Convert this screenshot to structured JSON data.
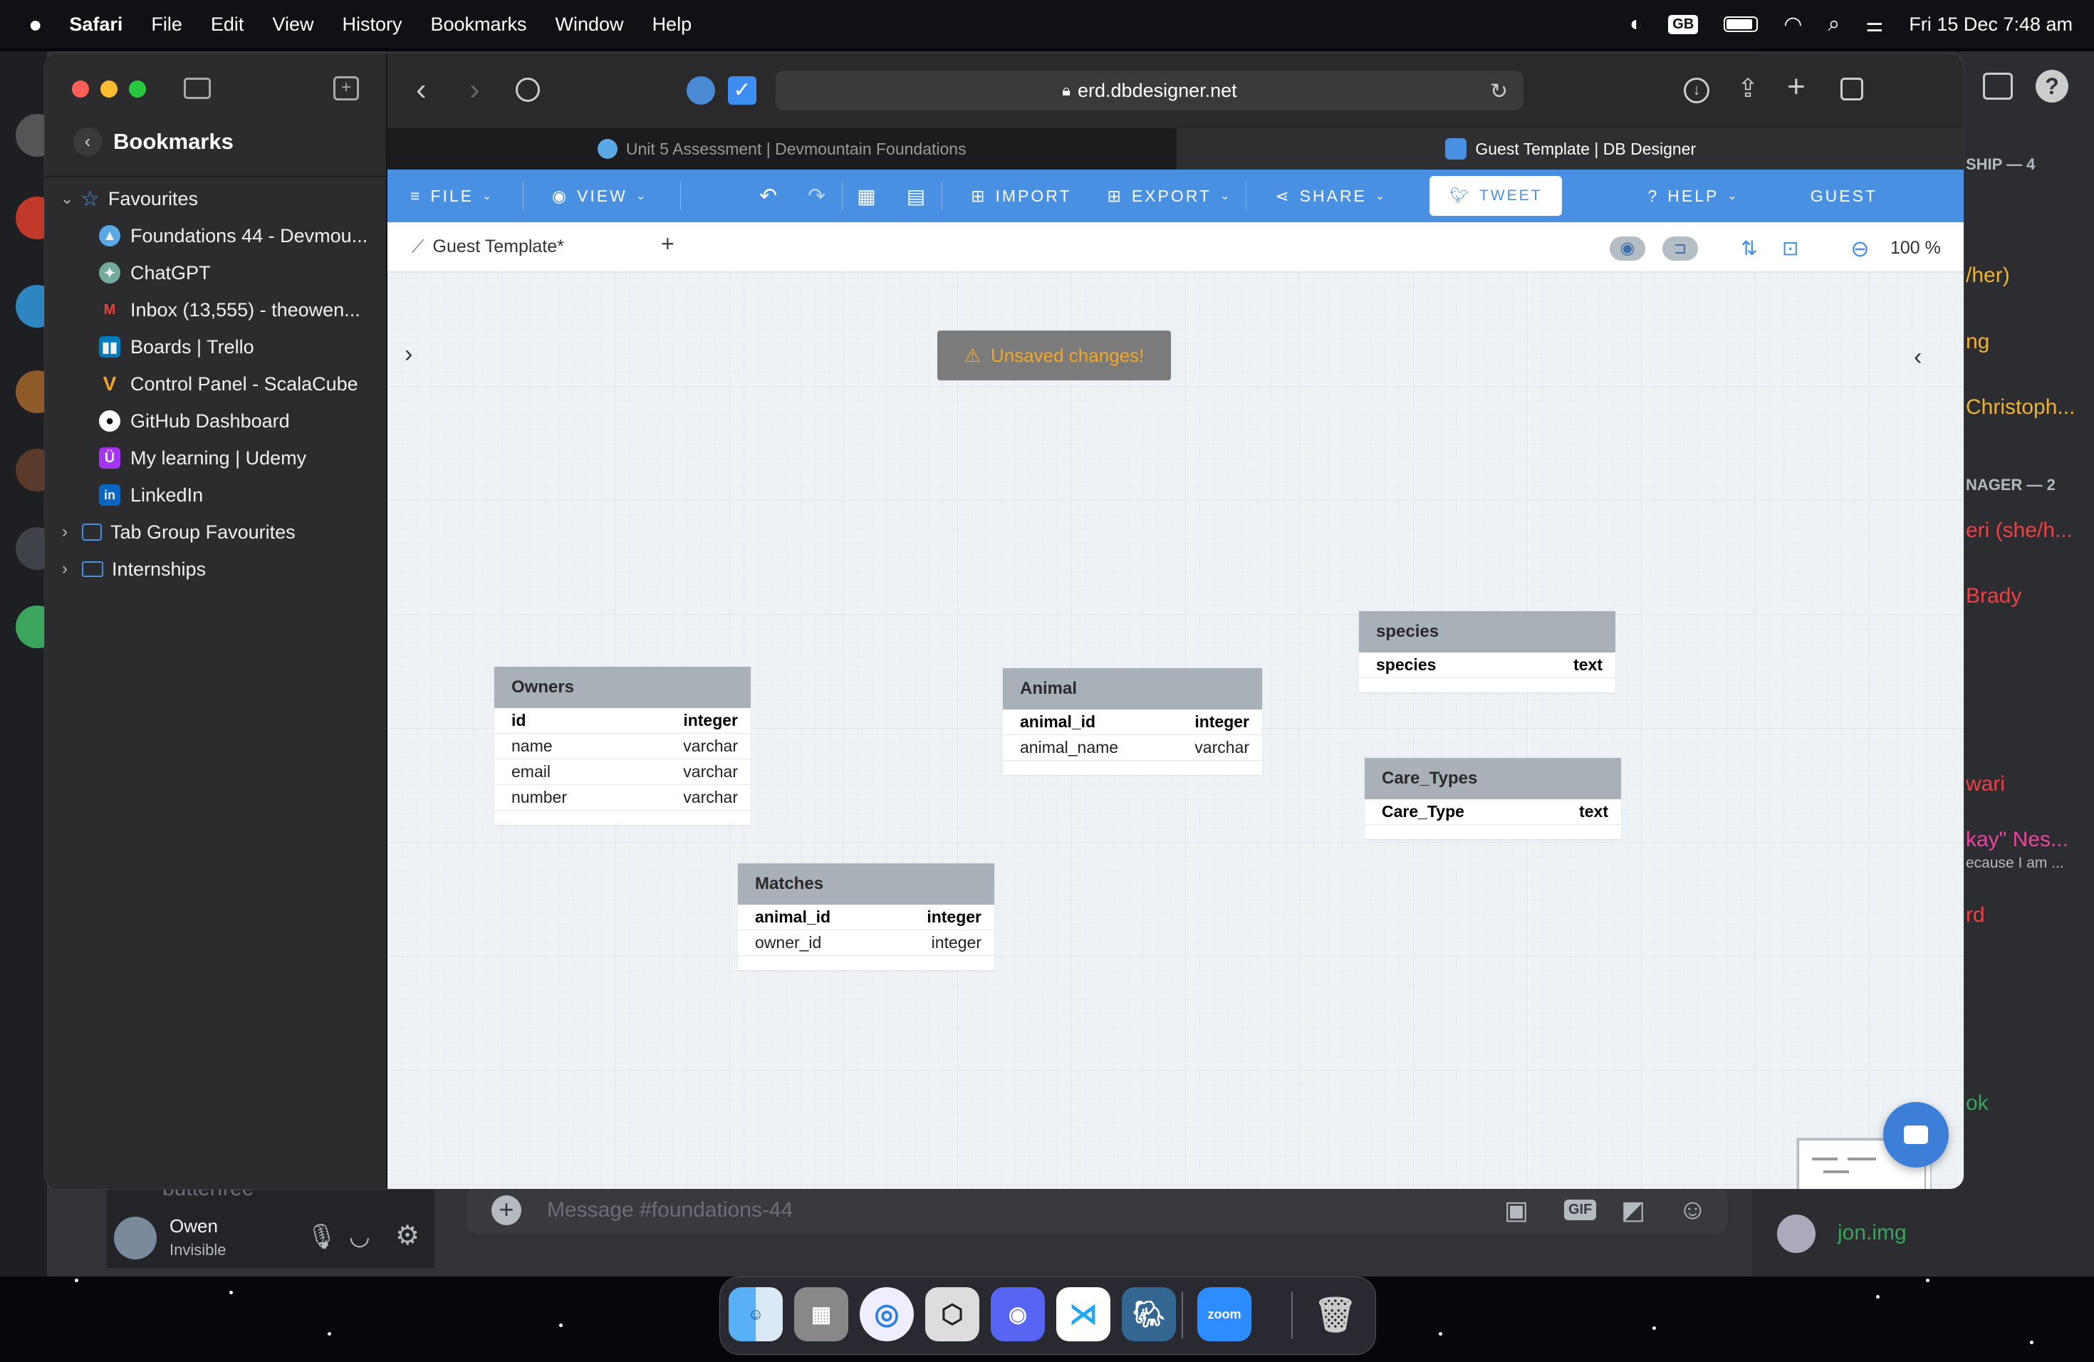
{
  "menubar": {
    "app": "Safari",
    "items": [
      "File",
      "Edit",
      "View",
      "History",
      "Bookmarks",
      "Window",
      "Help"
    ],
    "keyboard": "GB",
    "datetime": "Fri 15 Dec  7:48 am"
  },
  "safari": {
    "url": "erd.dbdesigner.net",
    "tabs": [
      {
        "label": "Unit 5 Assessment | Devmountain Foundations",
        "active": false
      },
      {
        "label": "Guest Template | DB Designer",
        "active": true
      }
    ]
  },
  "sidebar": {
    "title": "Bookmarks",
    "favourites_label": "Favourites",
    "items": [
      {
        "label": "Foundations 44 - Devmou...",
        "icon": "devmountain-icon",
        "color": "#5aa9e6"
      },
      {
        "label": "ChatGPT",
        "icon": "chatgpt-icon",
        "color": "#74aa9c"
      },
      {
        "label": "Inbox (13,555) - theowen...",
        "icon": "gmail-icon",
        "color": "#ea4335"
      },
      {
        "label": "Boards | Trello",
        "icon": "trello-icon",
        "color": "#0079bf"
      },
      {
        "label": "Control Panel - ScalaCube",
        "icon": "scalacube-icon",
        "color": "#f5a623"
      },
      {
        "label": "GitHub Dashboard",
        "icon": "github-icon",
        "color": "#ffffff"
      },
      {
        "label": "My learning | Udemy",
        "icon": "udemy-icon",
        "color": "#a435f0"
      },
      {
        "label": "LinkedIn",
        "icon": "linkedin-icon",
        "color": "#0a66c2"
      }
    ],
    "groups": [
      "Tab Group Favourites",
      "Internships"
    ]
  },
  "erd_toolbar": {
    "file": "FILE",
    "view": "VIEW",
    "import": "IMPORT",
    "export": "EXPORT",
    "share": "SHARE",
    "tweet": "TWEET",
    "help": "HELP",
    "guest": "GUEST"
  },
  "doc": {
    "tab_label": "Guest Template*",
    "zoom": "100 %",
    "unsaved": "Unsaved changes!"
  },
  "tables": {
    "owners": {
      "name": "Owners",
      "rows": [
        {
          "col": "id",
          "type": "integer",
          "pk": true
        },
        {
          "col": "name",
          "type": "varchar"
        },
        {
          "col": "email",
          "type": "varchar"
        },
        {
          "col": "number",
          "type": "varchar"
        }
      ]
    },
    "animal": {
      "name": "Animal",
      "rows": [
        {
          "col": "animal_id",
          "type": "integer",
          "pk": true
        },
        {
          "col": "animal_name",
          "type": "varchar"
        }
      ]
    },
    "species": {
      "name": "species",
      "rows": [
        {
          "col": "species",
          "type": "text",
          "pk": true
        }
      ]
    },
    "care_types": {
      "name": "Care_Types",
      "rows": [
        {
          "col": "Care_Type",
          "type": "text",
          "pk": true
        }
      ]
    },
    "matches": {
      "name": "Matches",
      "rows": [
        {
          "col": "animal_id",
          "type": "integer",
          "pk": true
        },
        {
          "col": "owner_id",
          "type": "integer"
        }
      ]
    }
  },
  "discord": {
    "user_name": "Owen",
    "user_status": "Invisible",
    "above_user": "butterfree",
    "message_placeholder": "Message #foundations-44",
    "member_bottom": "jon.img",
    "member_fragments": [
      {
        "text": "SHIP — 4",
        "color": "#b5bac1"
      },
      {
        "text": "/her)",
        "color": "#f0b232"
      },
      {
        "text": "ng",
        "color": "#f0b232"
      },
      {
        "text": "Christoph...",
        "color": "#f0b232"
      },
      {
        "text": "NAGER — 2",
        "color": "#b5bac1"
      },
      {
        "text": "eri (she/h...",
        "color": "#f23f43"
      },
      {
        "text": "Brady",
        "color": "#f23f43"
      },
      {
        "text": "wari",
        "color": "#f23f43"
      },
      {
        "text": "kay\" Nes...",
        "color": "#eb459e"
      },
      {
        "text": "ecause I am ...",
        "color": "#b5bac1"
      },
      {
        "text": "rd",
        "color": "#f23f43"
      },
      {
        "text": "ok",
        "color": "#3ba55d"
      }
    ]
  },
  "dock": [
    "Finder",
    "Launchpad",
    "Safari",
    "Unity",
    "Discord",
    "VS Code",
    "pgAdmin",
    "zoom",
    "Trash"
  ]
}
